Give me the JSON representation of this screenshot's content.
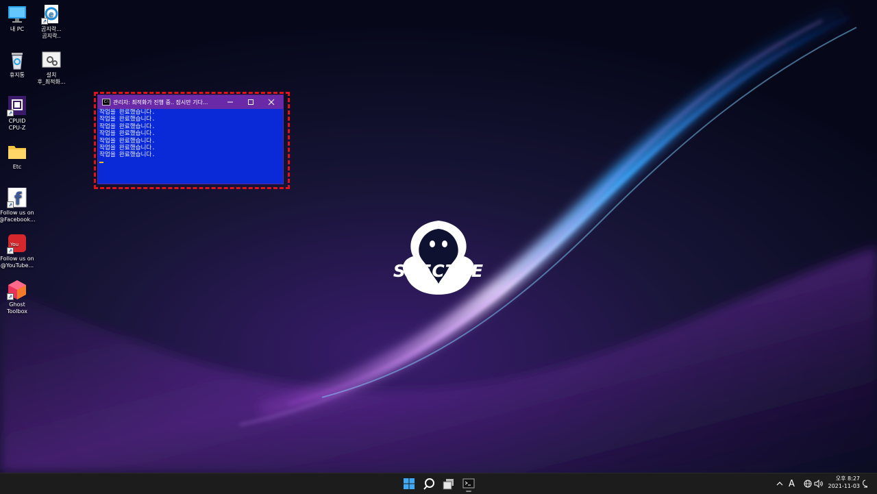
{
  "desktop": {
    "icons": [
      {
        "label": "내 PC",
        "icon": "computer-icon"
      },
      {
        "label": "곰지락...\n곰지락..",
        "icon": "internet-explorer-icon"
      },
      {
        "label": "휴지통",
        "icon": "recycle-bin-icon"
      },
      {
        "label": "설치\n후_최적화...",
        "icon": "settings-file-icon"
      },
      {
        "label": "CPUID\nCPU-Z",
        "icon": "cpuz-icon"
      },
      {
        "label": "Etc",
        "icon": "folder-icon"
      },
      {
        "label": "Follow us on\n@Facebook...",
        "icon": "facebook-icon"
      },
      {
        "label": "Follow us on\n@YouTube...",
        "icon": "youtube-icon"
      },
      {
        "label": "Ghost\nToolbox",
        "icon": "ghost-toolbox-icon"
      }
    ]
  },
  "console": {
    "title": "관리자:  최적화가 진행 중.. 잠시만 기다...",
    "icon": "cmd-icon",
    "lines": [
      "작업을 완료했습니다.",
      "작업을 완료했습니다.",
      "작업을 완료했습니다.",
      "작업을 완료했습니다.",
      "작업을 완료했습니다.",
      "작업을 완료했습니다.",
      "작업을 완료했습니다."
    ],
    "highlight_color": "#e0121c",
    "background_color": "#0a2ad8",
    "titlebar_color": "#6a2aa8"
  },
  "logo": {
    "text": "SPECTRE"
  },
  "taskbar": {
    "items": [
      "start-icon",
      "search-icon",
      "task-view-icon",
      "terminal-icon"
    ],
    "tray": {
      "ime": "A",
      "time": "오후 8:27",
      "date": "2021-11-03"
    }
  }
}
